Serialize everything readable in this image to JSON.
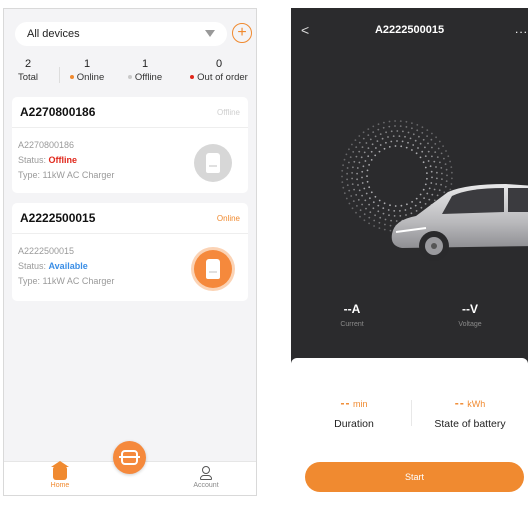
{
  "colors": {
    "accent": "#f08a30",
    "offline": "#e0271b",
    "available": "#3a8ee6",
    "online_dot": "#f08a30"
  },
  "list_screen": {
    "device_filter": {
      "selected": "All devices"
    },
    "stats": [
      {
        "count": "2",
        "label": "Total",
        "dot": null
      },
      {
        "count": "1",
        "label": "Online",
        "dot": "#f08a30"
      },
      {
        "count": "1",
        "label": "Offline",
        "dot": "#c9c9c9"
      },
      {
        "count": "0",
        "label": "Out of order",
        "dot": "#e0271b"
      }
    ],
    "devices": [
      {
        "id": "A2270800186",
        "tag": "Offline",
        "serial": "A2270800186",
        "status_prefix": "Status: ",
        "status": "Offline",
        "type": "Type: 11kW AC Charger"
      },
      {
        "id": "A2222500015",
        "tag": "Online",
        "serial": "A2222500015",
        "status_prefix": "Status: ",
        "status": "Available",
        "type": "Type: 11kW AC Charger"
      }
    ],
    "tabs": {
      "home": "Home",
      "account": "Account"
    }
  },
  "detail_screen": {
    "title": "A2222500015",
    "more": "...",
    "current": {
      "value": "--A",
      "label": "Current"
    },
    "voltage": {
      "value": "--V",
      "label": "Voltage"
    },
    "duration": {
      "value": "--",
      "unit": "min",
      "label": "Duration"
    },
    "battery": {
      "value": "--",
      "unit": "kWh",
      "label": "State of battery"
    },
    "start_label": "Start"
  }
}
